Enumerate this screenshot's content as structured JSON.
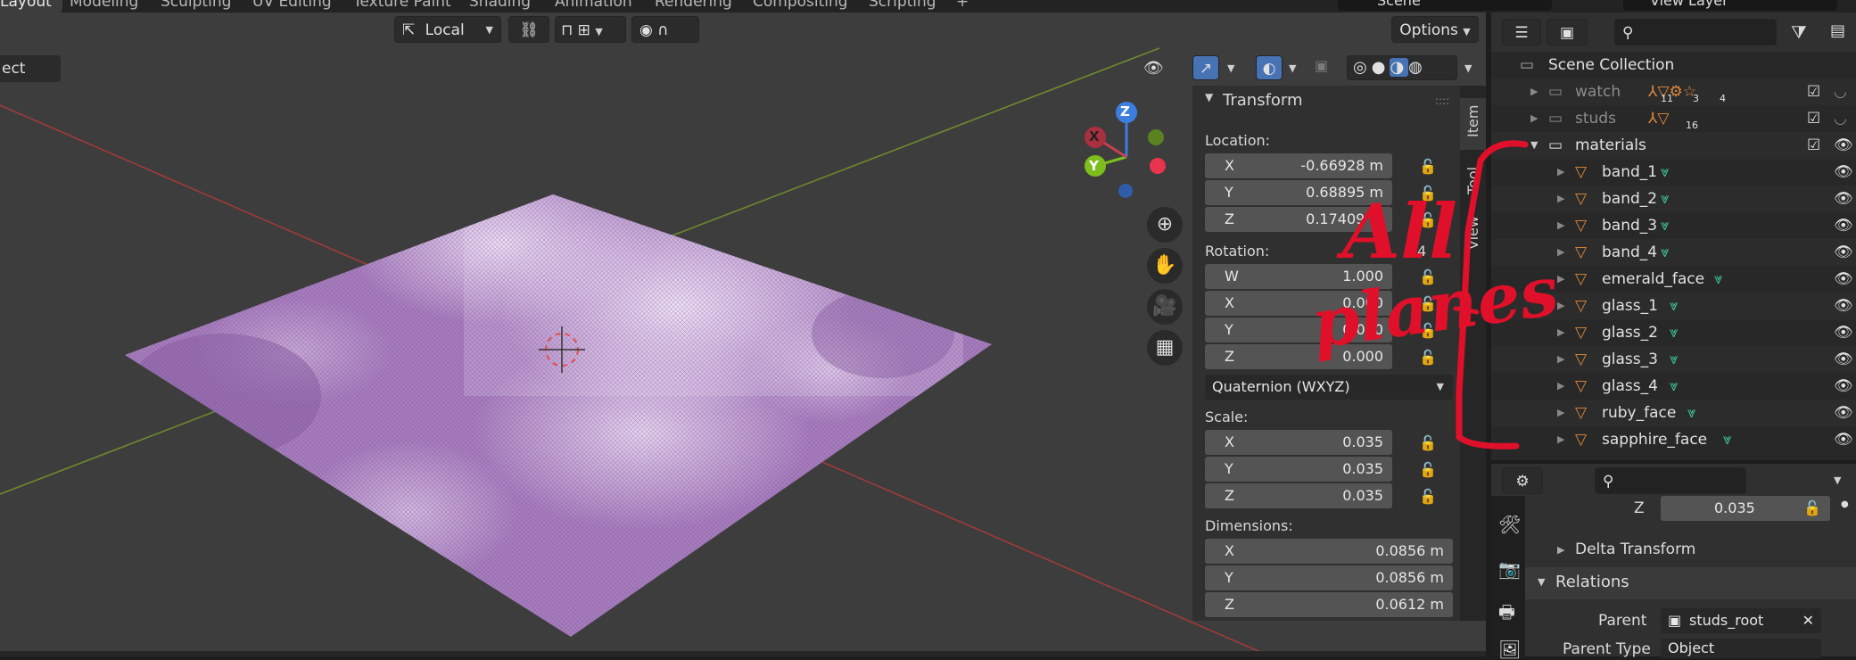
{
  "workspace_tabs": [
    "Layout",
    "Modeling",
    "Sculpting",
    "UV Editing",
    "Texture Paint",
    "Shading",
    "Animation",
    "Rendering",
    "Compositing",
    "Scripting"
  ],
  "top_right": {
    "scene": "Scene",
    "view_layer": "View Layer"
  },
  "viewport_header": {
    "transform_orientation": "Local",
    "options_label": "Options",
    "mode_label_partial": "ect"
  },
  "gizmo": {
    "z": "Z",
    "y": "Y",
    "x": "X"
  },
  "n_panel": {
    "tabs": [
      "Item",
      "Tool",
      "View"
    ],
    "section_title": "Transform",
    "location_label": "Location:",
    "location": [
      {
        "axis": "X",
        "value": "-0.66928 m"
      },
      {
        "axis": "Y",
        "value": "0.68895 m"
      },
      {
        "axis": "Z",
        "value": "0.17409 m"
      }
    ],
    "rotation_label": "Rotation:",
    "rotation": [
      {
        "axis": "W",
        "value": "1.000"
      },
      {
        "axis": "X",
        "value": "0.000"
      },
      {
        "axis": "Y",
        "value": "0.000"
      },
      {
        "axis": "Z",
        "value": "0.000"
      }
    ],
    "rotation_extra": "4",
    "rotation_mode": "Quaternion (WXYZ)",
    "scale_label": "Scale:",
    "scale": [
      {
        "axis": "X",
        "value": "0.035"
      },
      {
        "axis": "Y",
        "value": "0.035"
      },
      {
        "axis": "Z",
        "value": "0.035"
      }
    ],
    "dimensions_label": "Dimensions:",
    "dimensions": [
      {
        "axis": "X",
        "value": "0.0856 m"
      },
      {
        "axis": "Y",
        "value": "0.0856 m"
      },
      {
        "axis": "Z",
        "value": "0.0612 m"
      }
    ]
  },
  "outliner": {
    "scene_collection": "Scene Collection",
    "collections": [
      {
        "name": "watch",
        "badges": [
          "11",
          "3",
          "4"
        ]
      },
      {
        "name": "studs",
        "badges": [
          "16"
        ]
      },
      {
        "name": "materials",
        "badges": []
      }
    ],
    "objects": [
      "band_1",
      "band_2",
      "band_3",
      "band_4",
      "emerald_face",
      "glass_1",
      "glass_2",
      "glass_3",
      "glass_4",
      "ruby_face",
      "sapphire_face"
    ]
  },
  "properties": {
    "scale_z_label": "Z",
    "scale_z_value": "0.035",
    "delta_transform": "Delta Transform",
    "relations": "Relations",
    "parent_label": "Parent",
    "parent_value": "studs_root",
    "parent_type_label": "Parent Type",
    "parent_type_value": "Object"
  },
  "annotation": {
    "line1": "All",
    "line2": "planes"
  },
  "colors": {
    "accent_blue": "#4772b3",
    "annotation_red": "#e0102a",
    "mesh_orange": "#e08a3c",
    "data_green": "#3fbf9a",
    "plane_purple": "#b98ad0"
  }
}
